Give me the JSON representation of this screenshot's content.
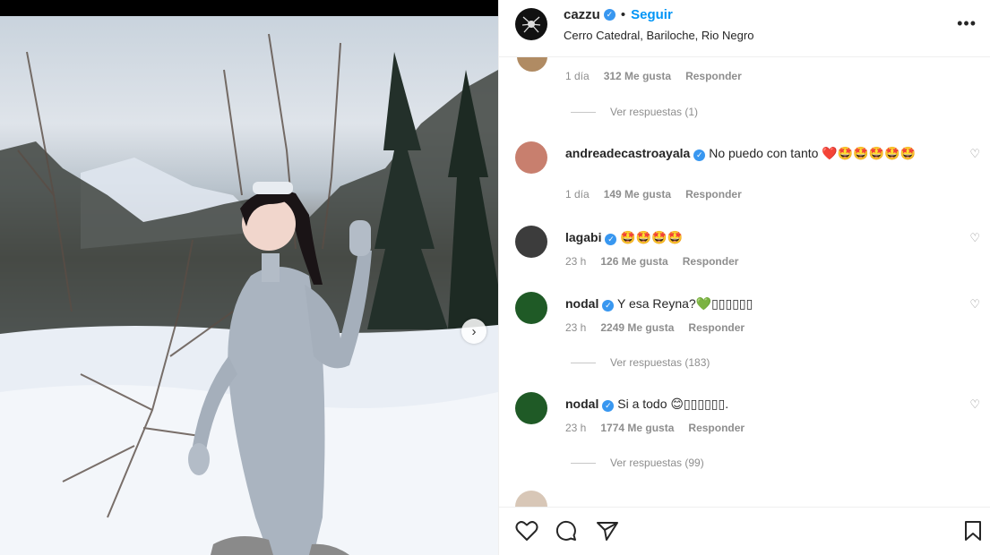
{
  "post": {
    "username": "cazzu",
    "follow_label": "Seguir",
    "separator": "•",
    "location": "Cerro Catedral, Bariloche, Rio Negro",
    "more_icon": "more-horizontal-icon",
    "carousel_icon": "chevron-right-icon"
  },
  "first_comment_meta": {
    "time": "1 día",
    "likes": "312 Me gusta",
    "reply": "Responder"
  },
  "first_replies": "Ver respuestas (1)",
  "comments": [
    {
      "user": "andreadecastroayala",
      "text": "No puedo con tanto ❤️🤩🤩🤩🤩🤩",
      "time": "1 día",
      "likes": "149 Me gusta",
      "reply": "Responder",
      "avatar_color": "#c87f6e"
    },
    {
      "user": "lagabi",
      "text": "🤩🤩🤩🤩",
      "time": "23 h",
      "likes": "126 Me gusta",
      "reply": "Responder",
      "avatar_color": "#3c3c3c"
    },
    {
      "user": "nodal",
      "text": "Y esa Reyna?💚▯▯▯▯▯▯",
      "time": "23 h",
      "likes": "2249 Me gusta",
      "reply": "Responder",
      "avatar_color": "#1f5a26",
      "replies": "Ver respuestas (183)"
    },
    {
      "user": "nodal",
      "text": "Si a todo 😊▯▯▯▯▯▯.",
      "time": "23 h",
      "likes": "1774 Me gusta",
      "reply": "Responder",
      "avatar_color": "#1f5a26",
      "replies": "Ver respuestas (99)"
    }
  ],
  "actions": {
    "like_icon": "heart-icon",
    "comment_icon": "comment-icon",
    "share_icon": "send-icon",
    "save_icon": "bookmark-icon"
  },
  "colors": {
    "accent": "#0095f6",
    "verified": "#3897f0",
    "muted": "#8e8e8e"
  }
}
